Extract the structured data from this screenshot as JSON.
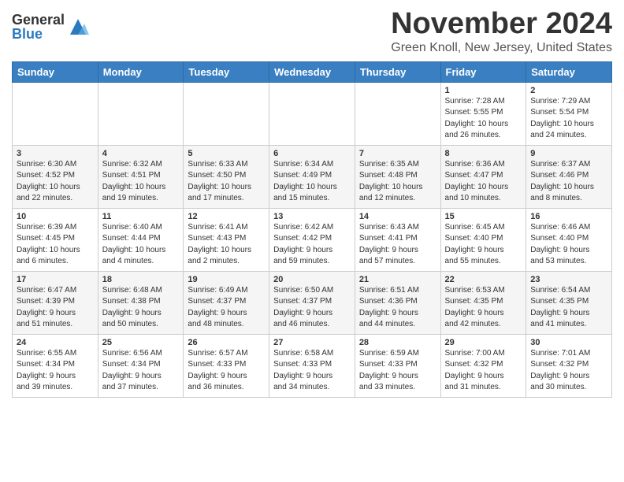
{
  "logo": {
    "general": "General",
    "blue": "Blue"
  },
  "title": "November 2024",
  "location": "Green Knoll, New Jersey, United States",
  "weekdays": [
    "Sunday",
    "Monday",
    "Tuesday",
    "Wednesday",
    "Thursday",
    "Friday",
    "Saturday"
  ],
  "weeks": [
    [
      {
        "day": "",
        "info": ""
      },
      {
        "day": "",
        "info": ""
      },
      {
        "day": "",
        "info": ""
      },
      {
        "day": "",
        "info": ""
      },
      {
        "day": "",
        "info": ""
      },
      {
        "day": "1",
        "info": "Sunrise: 7:28 AM\nSunset: 5:55 PM\nDaylight: 10 hours\nand 26 minutes."
      },
      {
        "day": "2",
        "info": "Sunrise: 7:29 AM\nSunset: 5:54 PM\nDaylight: 10 hours\nand 24 minutes."
      }
    ],
    [
      {
        "day": "3",
        "info": "Sunrise: 6:30 AM\nSunset: 4:52 PM\nDaylight: 10 hours\nand 22 minutes."
      },
      {
        "day": "4",
        "info": "Sunrise: 6:32 AM\nSunset: 4:51 PM\nDaylight: 10 hours\nand 19 minutes."
      },
      {
        "day": "5",
        "info": "Sunrise: 6:33 AM\nSunset: 4:50 PM\nDaylight: 10 hours\nand 17 minutes."
      },
      {
        "day": "6",
        "info": "Sunrise: 6:34 AM\nSunset: 4:49 PM\nDaylight: 10 hours\nand 15 minutes."
      },
      {
        "day": "7",
        "info": "Sunrise: 6:35 AM\nSunset: 4:48 PM\nDaylight: 10 hours\nand 12 minutes."
      },
      {
        "day": "8",
        "info": "Sunrise: 6:36 AM\nSunset: 4:47 PM\nDaylight: 10 hours\nand 10 minutes."
      },
      {
        "day": "9",
        "info": "Sunrise: 6:37 AM\nSunset: 4:46 PM\nDaylight: 10 hours\nand 8 minutes."
      }
    ],
    [
      {
        "day": "10",
        "info": "Sunrise: 6:39 AM\nSunset: 4:45 PM\nDaylight: 10 hours\nand 6 minutes."
      },
      {
        "day": "11",
        "info": "Sunrise: 6:40 AM\nSunset: 4:44 PM\nDaylight: 10 hours\nand 4 minutes."
      },
      {
        "day": "12",
        "info": "Sunrise: 6:41 AM\nSunset: 4:43 PM\nDaylight: 10 hours\nand 2 minutes."
      },
      {
        "day": "13",
        "info": "Sunrise: 6:42 AM\nSunset: 4:42 PM\nDaylight: 9 hours\nand 59 minutes."
      },
      {
        "day": "14",
        "info": "Sunrise: 6:43 AM\nSunset: 4:41 PM\nDaylight: 9 hours\nand 57 minutes."
      },
      {
        "day": "15",
        "info": "Sunrise: 6:45 AM\nSunset: 4:40 PM\nDaylight: 9 hours\nand 55 minutes."
      },
      {
        "day": "16",
        "info": "Sunrise: 6:46 AM\nSunset: 4:40 PM\nDaylight: 9 hours\nand 53 minutes."
      }
    ],
    [
      {
        "day": "17",
        "info": "Sunrise: 6:47 AM\nSunset: 4:39 PM\nDaylight: 9 hours\nand 51 minutes."
      },
      {
        "day": "18",
        "info": "Sunrise: 6:48 AM\nSunset: 4:38 PM\nDaylight: 9 hours\nand 50 minutes."
      },
      {
        "day": "19",
        "info": "Sunrise: 6:49 AM\nSunset: 4:37 PM\nDaylight: 9 hours\nand 48 minutes."
      },
      {
        "day": "20",
        "info": "Sunrise: 6:50 AM\nSunset: 4:37 PM\nDaylight: 9 hours\nand 46 minutes."
      },
      {
        "day": "21",
        "info": "Sunrise: 6:51 AM\nSunset: 4:36 PM\nDaylight: 9 hours\nand 44 minutes."
      },
      {
        "day": "22",
        "info": "Sunrise: 6:53 AM\nSunset: 4:35 PM\nDaylight: 9 hours\nand 42 minutes."
      },
      {
        "day": "23",
        "info": "Sunrise: 6:54 AM\nSunset: 4:35 PM\nDaylight: 9 hours\nand 41 minutes."
      }
    ],
    [
      {
        "day": "24",
        "info": "Sunrise: 6:55 AM\nSunset: 4:34 PM\nDaylight: 9 hours\nand 39 minutes."
      },
      {
        "day": "25",
        "info": "Sunrise: 6:56 AM\nSunset: 4:34 PM\nDaylight: 9 hours\nand 37 minutes."
      },
      {
        "day": "26",
        "info": "Sunrise: 6:57 AM\nSunset: 4:33 PM\nDaylight: 9 hours\nand 36 minutes."
      },
      {
        "day": "27",
        "info": "Sunrise: 6:58 AM\nSunset: 4:33 PM\nDaylight: 9 hours\nand 34 minutes."
      },
      {
        "day": "28",
        "info": "Sunrise: 6:59 AM\nSunset: 4:33 PM\nDaylight: 9 hours\nand 33 minutes."
      },
      {
        "day": "29",
        "info": "Sunrise: 7:00 AM\nSunset: 4:32 PM\nDaylight: 9 hours\nand 31 minutes."
      },
      {
        "day": "30",
        "info": "Sunrise: 7:01 AM\nSunset: 4:32 PM\nDaylight: 9 hours\nand 30 minutes."
      }
    ]
  ]
}
